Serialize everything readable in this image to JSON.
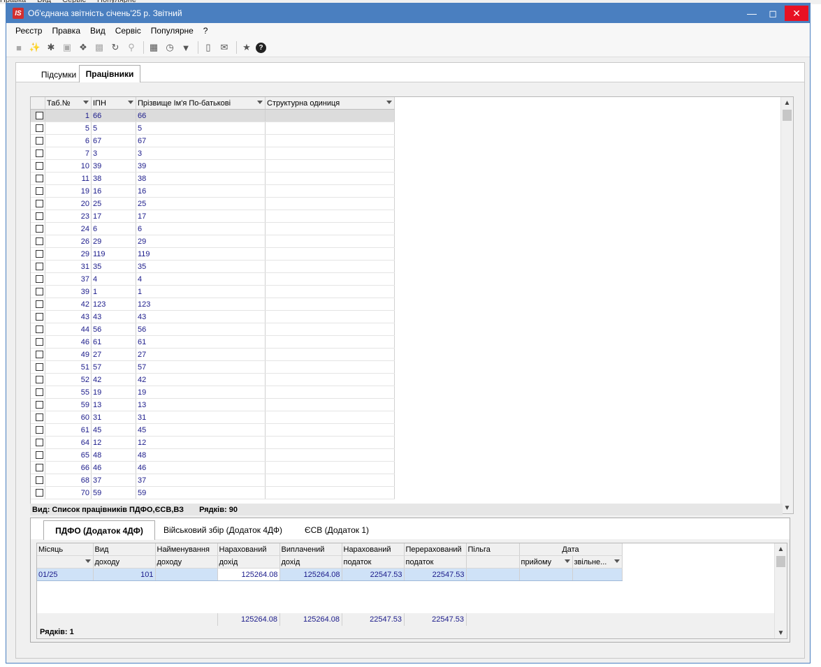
{
  "window": {
    "title": "Об'єднана звітність січень'25 р. Звітний",
    "logo": "IS"
  },
  "menu": [
    "Реєстр",
    "Правка",
    "Вид",
    "Сервіс",
    "Популярне",
    "?"
  ],
  "toolbar_icons": [
    "folder-icon",
    "new-doc-icon",
    "new-copy-icon",
    "print-icon",
    "copy-icon",
    "delete-icon",
    "refresh-icon",
    "search-icon",
    "table-icon",
    "history-icon",
    "filter-icon",
    "document-icon",
    "mail-icon",
    "star-icon",
    "help-icon"
  ],
  "top_tabs": [
    {
      "label": "Підсумки",
      "active": false
    },
    {
      "label": "Працівники",
      "active": true
    }
  ],
  "employees": {
    "columns": [
      "Таб.№",
      "ІПН",
      "Прізвище Ім'я По-батькові",
      "Структурна одиниця"
    ],
    "rows": [
      [
        "1",
        "66",
        "66",
        ""
      ],
      [
        "5",
        "5",
        "5",
        ""
      ],
      [
        "6",
        "67",
        "67",
        ""
      ],
      [
        "7",
        "3",
        "3",
        ""
      ],
      [
        "10",
        "39",
        "39",
        ""
      ],
      [
        "11",
        "38",
        "38",
        ""
      ],
      [
        "19",
        "16",
        "16",
        ""
      ],
      [
        "20",
        "25",
        "25",
        ""
      ],
      [
        "23",
        "17",
        "17",
        ""
      ],
      [
        "24",
        "6",
        "6",
        ""
      ],
      [
        "26",
        "29",
        "29",
        ""
      ],
      [
        "29",
        "119",
        "119",
        ""
      ],
      [
        "31",
        "35",
        "35",
        ""
      ],
      [
        "37",
        "4",
        "4",
        ""
      ],
      [
        "39",
        "1",
        "1",
        ""
      ],
      [
        "42",
        "123",
        "123",
        ""
      ],
      [
        "43",
        "43",
        "43",
        ""
      ],
      [
        "44",
        "56",
        "56",
        ""
      ],
      [
        "46",
        "61",
        "61",
        ""
      ],
      [
        "49",
        "27",
        "27",
        ""
      ],
      [
        "51",
        "57",
        "57",
        ""
      ],
      [
        "52",
        "42",
        "42",
        ""
      ],
      [
        "55",
        "19",
        "19",
        ""
      ],
      [
        "59",
        "13",
        "13",
        ""
      ],
      [
        "60",
        "31",
        "31",
        ""
      ],
      [
        "61",
        "45",
        "45",
        ""
      ],
      [
        "64",
        "12",
        "12",
        ""
      ],
      [
        "65",
        "48",
        "48",
        ""
      ],
      [
        "66",
        "46",
        "46",
        ""
      ],
      [
        "68",
        "37",
        "37",
        ""
      ],
      [
        "70",
        "59",
        "59",
        ""
      ]
    ],
    "status_view": "Вид: Список працівників ПДФО,ЄСВ,ВЗ",
    "status_rows": "Рядків: 90"
  },
  "bottom_tabs": [
    {
      "label": "ПДФО (Додаток 4ДФ)",
      "active": true
    },
    {
      "label": "Військовий збір (Додаток 4ДФ)",
      "active": false
    },
    {
      "label": "ЄСВ (Додаток 1)",
      "active": false
    }
  ],
  "pdfo": {
    "header_top": [
      "Місяць",
      "Вид",
      "Найменування",
      "Нарахований",
      "Виплачений",
      "Нарахований",
      "Перерахований",
      "Пільга",
      "Дата"
    ],
    "header_bottom": [
      "",
      "доходу",
      "доходу",
      "дохід",
      "дохід",
      "податок",
      "податок",
      "",
      "прийому",
      "звільне..."
    ],
    "row": [
      "01/25",
      "101",
      "",
      "125264.08",
      "125264.08",
      "22547.53",
      "22547.53",
      "",
      "",
      ""
    ],
    "totals": [
      "125264.08",
      "125264.08",
      "22547.53",
      "22547.53"
    ],
    "status_rows": "Рядків: 1"
  }
}
